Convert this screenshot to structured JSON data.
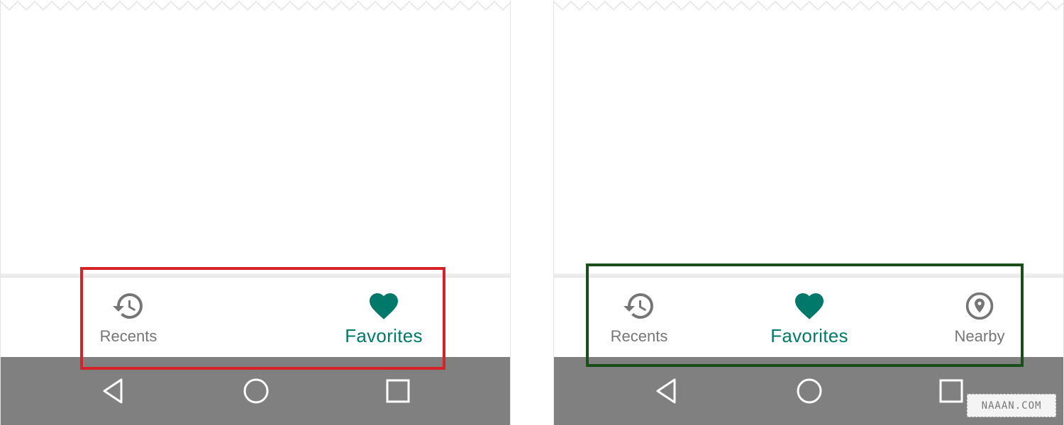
{
  "colors": {
    "active": "#00796b",
    "inactive": "#757575",
    "system_nav_bg": "#808080",
    "highlight_bad": "#d62328",
    "highlight_good": "#1a4d1a"
  },
  "left_example": {
    "nav_items": [
      {
        "label": "Recents",
        "icon": "history-icon",
        "active": false
      },
      {
        "label": "Favorites",
        "icon": "heart-icon",
        "active": true
      }
    ]
  },
  "right_example": {
    "nav_items": [
      {
        "label": "Recents",
        "icon": "history-icon",
        "active": false
      },
      {
        "label": "Favorites",
        "icon": "heart-icon",
        "active": true
      },
      {
        "label": "Nearby",
        "icon": "location-icon",
        "active": false
      }
    ]
  },
  "system_nav": {
    "buttons": [
      "back-icon",
      "home-icon",
      "recents-square-icon"
    ]
  },
  "watermark": "NAAAN.COM"
}
